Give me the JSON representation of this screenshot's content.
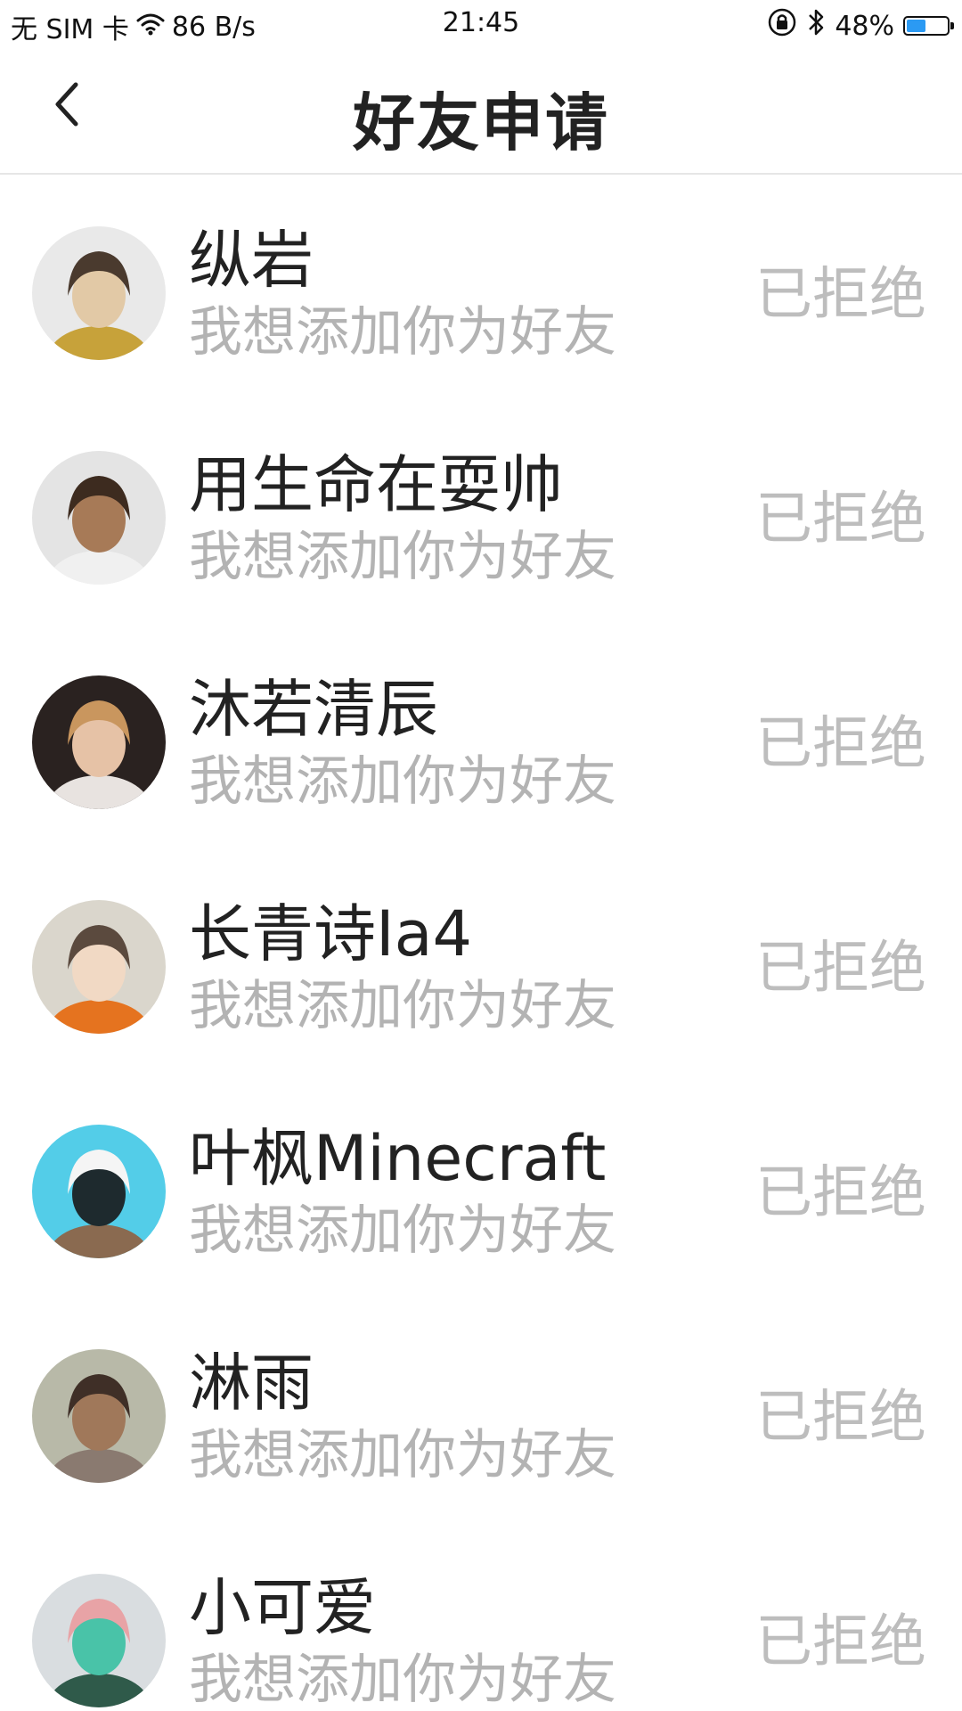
{
  "status_bar": {
    "carrier": "无 SIM 卡",
    "speed": "86 B/s",
    "time": "21:45",
    "battery_text": "48%",
    "battery_level": 0.48,
    "battery_color": "#2b9af3"
  },
  "header": {
    "title": "好友申请",
    "back_icon": "chevron-left-icon"
  },
  "requests": [
    {
      "name": "纵岩",
      "message": "我想添加你为好友",
      "status": "已拒绝",
      "avatar_colors": [
        "#e9e9e9",
        "#4a3a2e",
        "#e2c9a6",
        "#c7a23a"
      ]
    },
    {
      "name": "用生命在耍帅",
      "message": "我想添加你为好友",
      "status": "已拒绝",
      "avatar_colors": [
        "#e4e4e4",
        "#3d2b1f",
        "#a77a57",
        "#f0f0f0"
      ]
    },
    {
      "name": "沐若清辰",
      "message": "我想添加你为好友",
      "status": "已拒绝",
      "avatar_colors": [
        "#2a2220",
        "#c9965e",
        "#e6c2a6",
        "#e8e3e0"
      ]
    },
    {
      "name": "长青诗Ia4",
      "message": "我想添加你为好友",
      "status": "已拒绝",
      "avatar_colors": [
        "#dad6cc",
        "#5b4a3e",
        "#f1d9c4",
        "#e5731f"
      ]
    },
    {
      "name": "叶枫Minecraft",
      "message": "我想添加你为好友",
      "status": "已拒绝",
      "avatar_colors": [
        "#53cde8",
        "#f5f5f5",
        "#1e2a2e",
        "#8a6a50"
      ]
    },
    {
      "name": "淋雨",
      "message": "我想添加你为好友",
      "status": "已拒绝",
      "avatar_colors": [
        "#b8b9a8",
        "#3f2f27",
        "#a0785a",
        "#8a7a70"
      ]
    },
    {
      "name": "小可爱",
      "message": "我想添加你为好友",
      "status": "已拒绝",
      "avatar_colors": [
        "#d9dde0",
        "#e8a3a6",
        "#49c3a8",
        "#2f5a4a"
      ]
    }
  ]
}
